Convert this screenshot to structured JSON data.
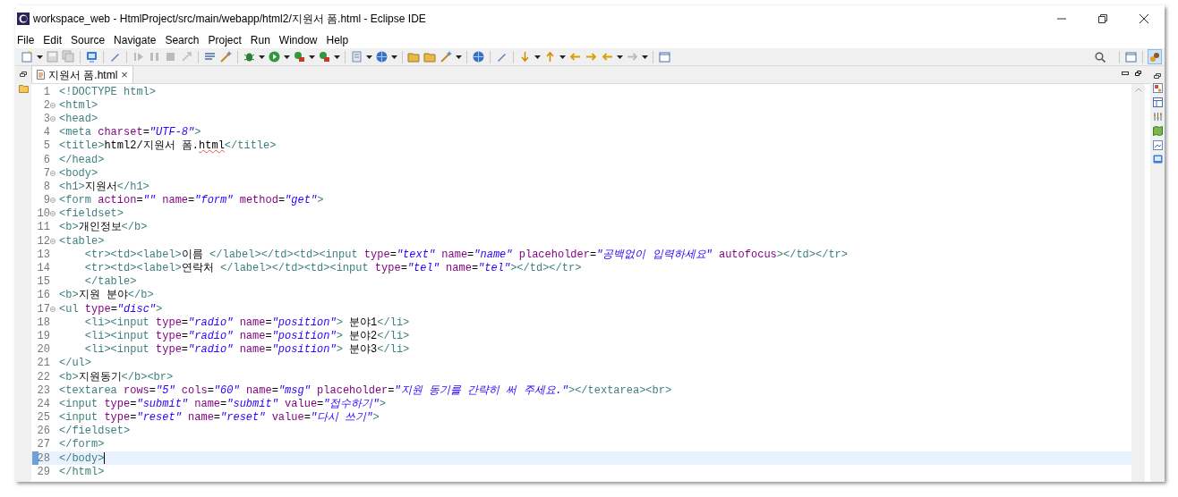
{
  "window": {
    "title": "workspace_web - HtmlProject/src/main/webapp/html2/지원서 폼.html - Eclipse IDE"
  },
  "menu": [
    "File",
    "Edit",
    "Source",
    "Navigate",
    "Search",
    "Project",
    "Run",
    "Window",
    "Help"
  ],
  "editor_tab": {
    "label": "지원서 폼.html",
    "close": "×",
    "selected": true
  },
  "lines": [
    {
      "number": "1",
      "fold": false,
      "current": false,
      "tokens": [
        {
          "kind": "tag",
          "text": "<!DOCTYPE html>"
        }
      ]
    },
    {
      "number": "2",
      "fold": true,
      "current": false,
      "tokens": [
        {
          "kind": "tag",
          "text": "<html>"
        }
      ]
    },
    {
      "number": "3",
      "fold": true,
      "current": false,
      "tokens": [
        {
          "kind": "tag",
          "text": "<head>"
        }
      ]
    },
    {
      "number": "4",
      "fold": false,
      "current": false,
      "tokens": [
        {
          "kind": "tag",
          "text": "<meta "
        },
        {
          "kind": "attr",
          "text": "charset"
        },
        {
          "kind": "plain",
          "text": "="
        },
        {
          "kind": "value",
          "text": "\"UTF-8\""
        },
        {
          "kind": "tag",
          "text": ">"
        }
      ]
    },
    {
      "number": "5",
      "fold": false,
      "current": false,
      "tokens": [
        {
          "kind": "tag",
          "text": "<title>"
        },
        {
          "kind": "text",
          "text": "html2/지원서 폼."
        },
        {
          "kind": "text",
          "text": "html",
          "misspelled": true
        },
        {
          "kind": "tag",
          "text": "</title>"
        }
      ]
    },
    {
      "number": "6",
      "fold": false,
      "current": false,
      "tokens": [
        {
          "kind": "tag",
          "text": "</head>"
        }
      ]
    },
    {
      "number": "7",
      "fold": true,
      "current": false,
      "tokens": [
        {
          "kind": "tag",
          "text": "<body>"
        }
      ]
    },
    {
      "number": "8",
      "fold": false,
      "current": false,
      "tokens": [
        {
          "kind": "tag",
          "text": "<h1>"
        },
        {
          "kind": "text",
          "text": "지원서"
        },
        {
          "kind": "tag",
          "text": "</h1>"
        }
      ]
    },
    {
      "number": "9",
      "fold": true,
      "current": false,
      "tokens": [
        {
          "kind": "tag",
          "text": "<form "
        },
        {
          "kind": "attr",
          "text": "action"
        },
        {
          "kind": "plain",
          "text": "="
        },
        {
          "kind": "value",
          "text": "\"\" "
        },
        {
          "kind": "attr",
          "text": "name"
        },
        {
          "kind": "plain",
          "text": "="
        },
        {
          "kind": "value",
          "text": "\"form\" "
        },
        {
          "kind": "attr",
          "text": "method"
        },
        {
          "kind": "plain",
          "text": "="
        },
        {
          "kind": "value",
          "text": "\"get\""
        },
        {
          "kind": "tag",
          "text": ">"
        }
      ]
    },
    {
      "number": "10",
      "fold": true,
      "current": false,
      "tokens": [
        {
          "kind": "tag",
          "text": "<fieldset>"
        }
      ]
    },
    {
      "number": "11",
      "fold": false,
      "current": false,
      "tokens": [
        {
          "kind": "tag",
          "text": "<b>"
        },
        {
          "kind": "text",
          "text": "개인정보"
        },
        {
          "kind": "tag",
          "text": "</b>"
        }
      ]
    },
    {
      "number": "12",
      "fold": true,
      "current": false,
      "tokens": [
        {
          "kind": "tag",
          "text": "<table>"
        }
      ]
    },
    {
      "number": "13",
      "fold": false,
      "current": false,
      "tokens": [
        {
          "kind": "tag",
          "text": "    <tr><td><label>"
        },
        {
          "kind": "text",
          "text": "이름 "
        },
        {
          "kind": "tag",
          "text": "</label></td><td><input "
        },
        {
          "kind": "attr",
          "text": "type"
        },
        {
          "kind": "plain",
          "text": "="
        },
        {
          "kind": "value",
          "text": "\"text\" "
        },
        {
          "kind": "attr",
          "text": "name"
        },
        {
          "kind": "plain",
          "text": "="
        },
        {
          "kind": "value",
          "text": "\"name\" "
        },
        {
          "kind": "attr",
          "text": "placeholder"
        },
        {
          "kind": "plain",
          "text": "="
        },
        {
          "kind": "value",
          "text": "\"공백없이 입력하세요\" "
        },
        {
          "kind": "attr",
          "text": "autofocus"
        },
        {
          "kind": "tag",
          "text": "></td></tr>"
        }
      ]
    },
    {
      "number": "14",
      "fold": false,
      "current": false,
      "tokens": [
        {
          "kind": "tag",
          "text": "    <tr><td><label>"
        },
        {
          "kind": "text",
          "text": "연락처 "
        },
        {
          "kind": "tag",
          "text": "</label></td><td><input "
        },
        {
          "kind": "attr",
          "text": "type"
        },
        {
          "kind": "plain",
          "text": "="
        },
        {
          "kind": "value",
          "text": "\"tel\" "
        },
        {
          "kind": "attr",
          "text": "name"
        },
        {
          "kind": "plain",
          "text": "="
        },
        {
          "kind": "value",
          "text": "\"tel\""
        },
        {
          "kind": "tag",
          "text": "></td></tr>"
        }
      ]
    },
    {
      "number": "15",
      "fold": false,
      "current": false,
      "tokens": [
        {
          "kind": "tag",
          "text": "    </table>"
        }
      ]
    },
    {
      "number": "16",
      "fold": false,
      "current": false,
      "tokens": [
        {
          "kind": "tag",
          "text": "<b>"
        },
        {
          "kind": "text",
          "text": "지원 분야"
        },
        {
          "kind": "tag",
          "text": "</b>"
        }
      ]
    },
    {
      "number": "17",
      "fold": true,
      "current": false,
      "tokens": [
        {
          "kind": "tag",
          "text": "<ul "
        },
        {
          "kind": "attr",
          "text": "type"
        },
        {
          "kind": "plain",
          "text": "="
        },
        {
          "kind": "value",
          "text": "\"disc\""
        },
        {
          "kind": "tag",
          "text": ">"
        }
      ]
    },
    {
      "number": "18",
      "fold": false,
      "current": false,
      "tokens": [
        {
          "kind": "tag",
          "text": "    <li><input "
        },
        {
          "kind": "attr",
          "text": "type"
        },
        {
          "kind": "plain",
          "text": "="
        },
        {
          "kind": "value",
          "text": "\"radio\" "
        },
        {
          "kind": "attr",
          "text": "name"
        },
        {
          "kind": "plain",
          "text": "="
        },
        {
          "kind": "value",
          "text": "\"position\""
        },
        {
          "kind": "tag",
          "text": ">"
        },
        {
          "kind": "text",
          "text": " 분야1"
        },
        {
          "kind": "tag",
          "text": "</li>"
        }
      ]
    },
    {
      "number": "19",
      "fold": false,
      "current": false,
      "tokens": [
        {
          "kind": "tag",
          "text": "    <li><input "
        },
        {
          "kind": "attr",
          "text": "type"
        },
        {
          "kind": "plain",
          "text": "="
        },
        {
          "kind": "value",
          "text": "\"radio\" "
        },
        {
          "kind": "attr",
          "text": "name"
        },
        {
          "kind": "plain",
          "text": "="
        },
        {
          "kind": "value",
          "text": "\"position\""
        },
        {
          "kind": "tag",
          "text": ">"
        },
        {
          "kind": "text",
          "text": " 분야2"
        },
        {
          "kind": "tag",
          "text": "</li>"
        }
      ]
    },
    {
      "number": "20",
      "fold": false,
      "current": false,
      "tokens": [
        {
          "kind": "tag",
          "text": "    <li><input "
        },
        {
          "kind": "attr",
          "text": "type"
        },
        {
          "kind": "plain",
          "text": "="
        },
        {
          "kind": "value",
          "text": "\"radio\" "
        },
        {
          "kind": "attr",
          "text": "name"
        },
        {
          "kind": "plain",
          "text": "="
        },
        {
          "kind": "value",
          "text": "\"position\""
        },
        {
          "kind": "tag",
          "text": ">"
        },
        {
          "kind": "text",
          "text": " 분야3"
        },
        {
          "kind": "tag",
          "text": "</li>"
        }
      ]
    },
    {
      "number": "21",
      "fold": false,
      "current": false,
      "tokens": [
        {
          "kind": "tag",
          "text": "</ul>"
        }
      ]
    },
    {
      "number": "22",
      "fold": false,
      "current": false,
      "tokens": [
        {
          "kind": "tag",
          "text": "<b>"
        },
        {
          "kind": "text",
          "text": "지원동기"
        },
        {
          "kind": "tag",
          "text": "</b><br>"
        }
      ]
    },
    {
      "number": "23",
      "fold": false,
      "current": false,
      "tokens": [
        {
          "kind": "tag",
          "text": "<textarea "
        },
        {
          "kind": "attr",
          "text": "rows"
        },
        {
          "kind": "plain",
          "text": "="
        },
        {
          "kind": "value",
          "text": "\"5\" "
        },
        {
          "kind": "attr",
          "text": "cols"
        },
        {
          "kind": "plain",
          "text": "="
        },
        {
          "kind": "value",
          "text": "\"60\" "
        },
        {
          "kind": "attr",
          "text": "name"
        },
        {
          "kind": "plain",
          "text": "="
        },
        {
          "kind": "value",
          "text": "\"msg\" "
        },
        {
          "kind": "attr",
          "text": "placeholder"
        },
        {
          "kind": "plain",
          "text": "="
        },
        {
          "kind": "value",
          "text": "\"지원 동기를 간략히 써 주세요.\""
        },
        {
          "kind": "tag",
          "text": "></textarea><br>"
        }
      ]
    },
    {
      "number": "24",
      "fold": false,
      "current": false,
      "tokens": [
        {
          "kind": "tag",
          "text": "<input "
        },
        {
          "kind": "attr",
          "text": "type"
        },
        {
          "kind": "plain",
          "text": "="
        },
        {
          "kind": "value",
          "text": "\"submit\" "
        },
        {
          "kind": "attr",
          "text": "name"
        },
        {
          "kind": "plain",
          "text": "="
        },
        {
          "kind": "value",
          "text": "\"submit\" "
        },
        {
          "kind": "attr",
          "text": "value"
        },
        {
          "kind": "plain",
          "text": "="
        },
        {
          "kind": "value",
          "text": "\"접수하기\""
        },
        {
          "kind": "tag",
          "text": ">"
        }
      ]
    },
    {
      "number": "25",
      "fold": false,
      "current": false,
      "tokens": [
        {
          "kind": "tag",
          "text": "<input "
        },
        {
          "kind": "attr",
          "text": "type"
        },
        {
          "kind": "plain",
          "text": "="
        },
        {
          "kind": "value",
          "text": "\"reset\" "
        },
        {
          "kind": "attr",
          "text": "name"
        },
        {
          "kind": "plain",
          "text": "="
        },
        {
          "kind": "value",
          "text": "\"reset\" "
        },
        {
          "kind": "attr",
          "text": "value"
        },
        {
          "kind": "plain",
          "text": "="
        },
        {
          "kind": "value",
          "text": "\"다시 쓰기\""
        },
        {
          "kind": "tag",
          "text": ">"
        }
      ]
    },
    {
      "number": "26",
      "fold": false,
      "current": false,
      "tokens": [
        {
          "kind": "tag",
          "text": "</fieldset>"
        }
      ]
    },
    {
      "number": "27",
      "fold": false,
      "current": false,
      "tokens": [
        {
          "kind": "tag",
          "text": "</form>"
        }
      ]
    },
    {
      "number": "28",
      "fold": false,
      "current": true,
      "tokens": [
        {
          "kind": "tag",
          "text": "</body>"
        }
      ]
    },
    {
      "number": "29",
      "fold": false,
      "current": false,
      "tokens": [
        {
          "kind": "tag",
          "text": "</html>"
        }
      ]
    }
  ]
}
